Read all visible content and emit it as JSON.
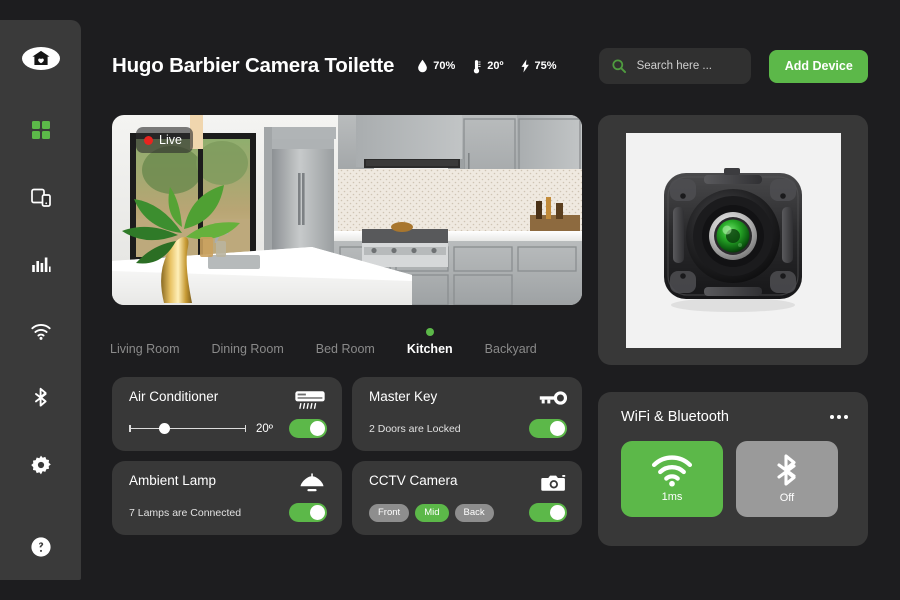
{
  "app": {
    "title": "Hugo Barbier Camera Toilette"
  },
  "sidebar": {
    "logo_icon": "home-heart-icon",
    "items": [
      {
        "icon": "grid-dashboard-icon",
        "name": "dashboard",
        "active": true
      },
      {
        "icon": "devices-icon",
        "name": "devices",
        "active": false
      },
      {
        "icon": "statistics-bars-icon",
        "name": "statistics",
        "active": false
      },
      {
        "icon": "wifi-icon",
        "name": "wifi",
        "active": false
      },
      {
        "icon": "bluetooth-icon",
        "name": "bluetooth",
        "active": false
      },
      {
        "icon": "gear-icon",
        "name": "settings",
        "active": false
      },
      {
        "icon": "help-icon",
        "name": "help",
        "active": false
      }
    ]
  },
  "header": {
    "stats": [
      {
        "icon": "humidity-drop-icon",
        "value": "70%"
      },
      {
        "icon": "thermometer-icon",
        "value": "20º"
      },
      {
        "icon": "bolt-icon",
        "value": "75%"
      }
    ],
    "search": {
      "icon": "search-icon",
      "placeholder": "Search here ...",
      "value": ""
    },
    "add_device_label": "Add Device"
  },
  "feed": {
    "live_label": "Live",
    "scene": "kitchen-camera-feed"
  },
  "rooms": {
    "tabs": [
      {
        "label": "Living Room",
        "active": false
      },
      {
        "label": "Dining Room",
        "active": false
      },
      {
        "label": "Bed Room",
        "active": false
      },
      {
        "label": "Kitchen",
        "active": true
      },
      {
        "label": "Backyard",
        "active": false
      }
    ]
  },
  "devices": [
    {
      "title": "Air Conditioner",
      "icon": "air-conditioner-icon",
      "control": "slider",
      "slider_percent": 30,
      "value_label": "20º",
      "toggle_on": true
    },
    {
      "title": "Master Key",
      "icon": "key-icon",
      "control": "status",
      "status": "2 Doors are Locked",
      "toggle_on": true
    },
    {
      "title": "Ambient Lamp",
      "icon": "lamp-icon",
      "control": "status",
      "status": "7 Lamps are Connected",
      "toggle_on": true
    },
    {
      "title": "CCTV Camera",
      "icon": "camera-icon",
      "control": "chips",
      "chips": [
        {
          "label": "Front",
          "active": false
        },
        {
          "label": "Mid",
          "active": true
        },
        {
          "label": "Back",
          "active": false
        }
      ],
      "toggle_on": true
    }
  ],
  "product": {
    "image": "security-camera-product-photo"
  },
  "connectivity": {
    "title": "WiFi & Bluetooth",
    "menu_icon": "more-options-icon",
    "tiles": [
      {
        "icon": "wifi-icon",
        "label": "1ms",
        "state": "on"
      },
      {
        "icon": "bluetooth-icon",
        "label": "Off",
        "state": "off"
      }
    ]
  },
  "colors": {
    "accent_green": "#5cb849",
    "background": "#1d1d1f",
    "card": "#383838",
    "sidebar": "#3a3a3a",
    "live_red": "#e8241f"
  }
}
